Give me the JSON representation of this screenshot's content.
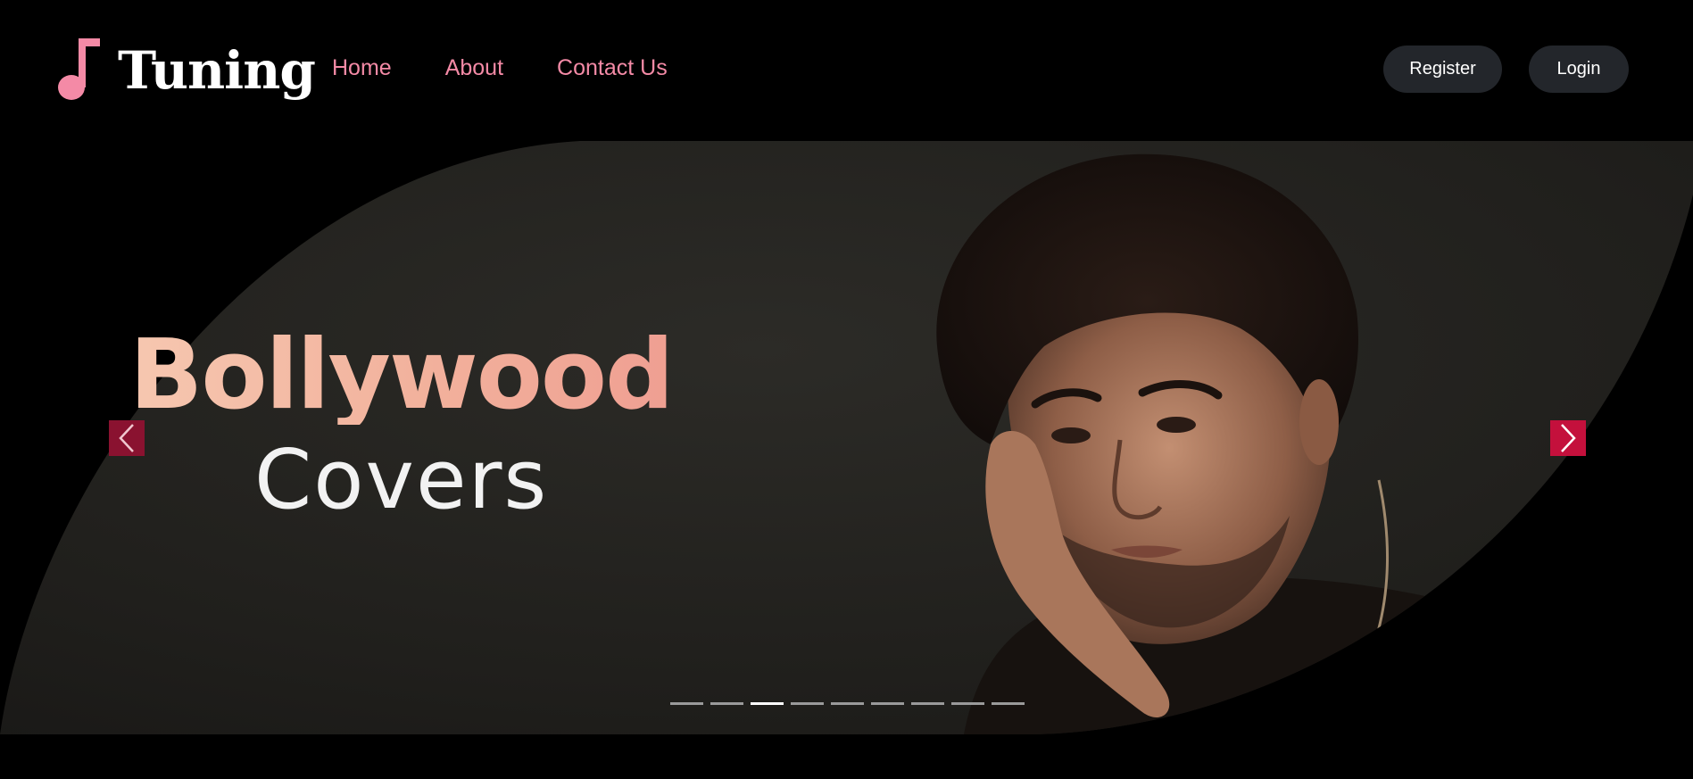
{
  "brand": {
    "name": "Tuning",
    "icon": "music-note-icon",
    "icon_color": "#f48aa6"
  },
  "nav": {
    "items": [
      {
        "label": "Home"
      },
      {
        "label": "About"
      },
      {
        "label": "Contact Us"
      }
    ],
    "link_color": "#f48aa6"
  },
  "auth": {
    "register_label": "Register",
    "login_label": "Login"
  },
  "hero": {
    "title": "Bollywood",
    "subtitle": "Covers",
    "prev_icon": "chevron-left-icon",
    "next_icon": "chevron-right-icon",
    "slide_count": 9,
    "active_slide": 3
  },
  "colors": {
    "background": "#000000",
    "accent": "#c4103c",
    "button_bg": "#23262b"
  }
}
